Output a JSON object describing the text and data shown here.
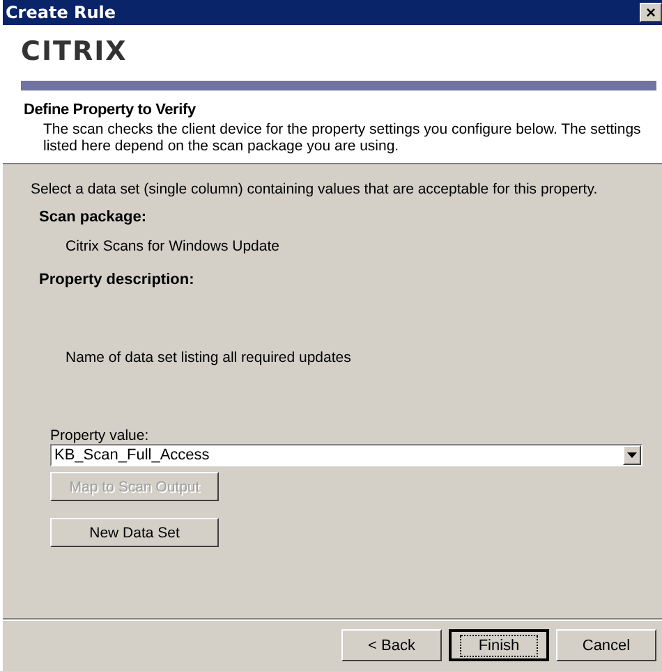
{
  "window": {
    "title": "Create Rule",
    "close": "×"
  },
  "header": {
    "logo": "CITRIX",
    "heading": "Define Property to Verify",
    "description": "The scan checks the client device for the property settings you configure below. The settings listed here depend on the scan package you are using."
  },
  "body": {
    "instruction": "Select a data set (single column) containing values that are acceptable for this property.",
    "scan_package": {
      "label": "Scan package:",
      "value": "Citrix Scans for Windows Update"
    },
    "property_description": {
      "label": "Property description:",
      "value": "Name of data set listing all required updates"
    },
    "property_value": {
      "label": "Property value:",
      "value": "KB_Scan_Full_Access"
    },
    "actions": [
      {
        "label": "Map to Scan Output",
        "disabled": true
      },
      {
        "label": "New Data Set",
        "disabled": false
      }
    ]
  },
  "footer": [
    {
      "label": "< Back",
      "default": false
    },
    {
      "label": "Finish",
      "default": true
    },
    {
      "label": "Cancel",
      "default": false
    }
  ]
}
